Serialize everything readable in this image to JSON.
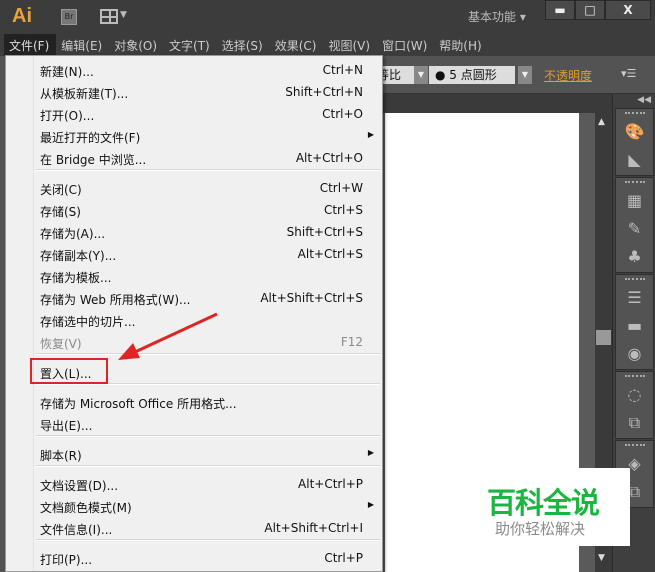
{
  "titlebar": {
    "logo": "Ai",
    "bridge": "Br",
    "workspace": "基本功能 ▾",
    "minimize": "▬",
    "maximize": "□",
    "close": "X"
  },
  "menubar": [
    "文件(F)",
    "编辑(E)",
    "对象(O)",
    "文字(T)",
    "选择(S)",
    "效果(C)",
    "视图(V)",
    "窗口(W)",
    "帮助(H)"
  ],
  "controlbar": {
    "scale": "等比",
    "brush": "●  5 点圆形",
    "opacity": "不透明度",
    "panel_menu": "▾☰"
  },
  "file_menu": [
    {
      "label": "新建(N)...",
      "shortcut": "Ctrl+N"
    },
    {
      "label": "从模板新建(T)...",
      "shortcut": "Shift+Ctrl+N"
    },
    {
      "label": "打开(O)...",
      "shortcut": "Ctrl+O"
    },
    {
      "label": "最近打开的文件(F)",
      "shortcut": "",
      "submenu": true
    },
    {
      "label": "在 Bridge 中浏览...",
      "shortcut": "Alt+Ctrl+O"
    },
    {
      "label": "关闭(C)",
      "shortcut": "Ctrl+W"
    },
    {
      "label": "存储(S)",
      "shortcut": "Ctrl+S"
    },
    {
      "label": "存储为(A)...",
      "shortcut": "Shift+Ctrl+S"
    },
    {
      "label": "存储副本(Y)...",
      "shortcut": "Alt+Ctrl+S"
    },
    {
      "label": "存储为模板...",
      "shortcut": ""
    },
    {
      "label": "存储为 Web 所用格式(W)...",
      "shortcut": "Alt+Shift+Ctrl+S"
    },
    {
      "label": "存储选中的切片...",
      "shortcut": ""
    },
    {
      "label": "恢复(V)",
      "shortcut": "F12",
      "disabled": true
    },
    {
      "label": "置入(L)...",
      "shortcut": "",
      "highlighted": true
    },
    {
      "label": "存储为 Microsoft Office 所用格式...",
      "shortcut": ""
    },
    {
      "label": "导出(E)...",
      "shortcut": ""
    },
    {
      "label": "脚本(R)",
      "shortcut": "",
      "submenu": true
    },
    {
      "label": "文档设置(D)...",
      "shortcut": "Alt+Ctrl+P"
    },
    {
      "label": "文档颜色模式(M)",
      "shortcut": "",
      "submenu": true
    },
    {
      "label": "文件信息(I)...",
      "shortcut": "Alt+Shift+Ctrl+I"
    },
    {
      "label": "打印(P)...",
      "shortcut": "Ctrl+P"
    }
  ],
  "watermark": {
    "title": "百科全说",
    "subtitle": "助你轻松解决"
  },
  "colors": {
    "annotation": "#e02424",
    "watermark": "#1db542",
    "opacity_link": "#e49b2f"
  }
}
